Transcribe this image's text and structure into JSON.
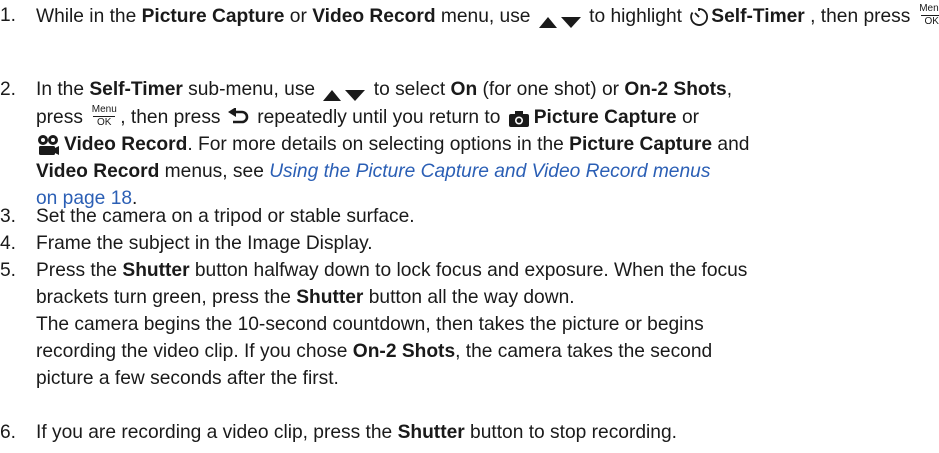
{
  "steps": [
    {
      "num": "1.",
      "a": "While in the ",
      "picture_capture": "Picture Capture",
      "or": " or ",
      "video_record": "Video Record",
      "b": " menu, use ",
      "c": " to highlight ",
      "self_timer": "Self-Timer",
      "d": " , then press ",
      "e": "."
    },
    {
      "num": "2.",
      "a": "In the ",
      "self_timer": "Self-Timer",
      "b": " sub-menu, use ",
      "c": " to select ",
      "on": "On",
      "d": " (for one shot) or ",
      "on2": "On-2 Shots",
      "e": ",",
      "f": "press ",
      "g": ", then press ",
      "h": " repeatedly until you return to ",
      "picture_capture": "Picture Capture",
      "i": " or",
      "video_record": "Video Record",
      "j": ". For more details on selecting options in the ",
      "picture_capture2": "Picture Capture",
      "k": " and",
      "video_record2": "Video Record",
      "l": " menus, see ",
      "xref_title": "Using the Picture Capture and Video Record menus",
      "xref_page": "on page 18",
      "m": "."
    },
    {
      "num": "3.",
      "text": "Set the camera on a tripod or stable surface."
    },
    {
      "num": "4.",
      "text": "Frame the subject in the Image Display."
    },
    {
      "num": "5.",
      "a": "Press the ",
      "shutter": "Shutter",
      "b": " button halfway down to lock focus and exposure. When the focus",
      "c": "brackets turn green, press the ",
      "shutter2": "Shutter",
      "d": " button all the way down.",
      "e": "The camera begins the 10-second countdown, then takes the picture or begins",
      "f": "recording the video clip. If you chose ",
      "on2": "On-2 Shots",
      "g": ", the camera takes the second",
      "h": "picture a few seconds after the first."
    },
    {
      "num": "6.",
      "a": "If you are recording a video clip, press the ",
      "shutter": "Shutter",
      "b": " button to stop recording."
    }
  ],
  "menu_ok": {
    "top": "Menu",
    "bottom": "OK"
  },
  "icons": {
    "arrows": "up-down-arrows-icon",
    "timer": "self-timer-icon",
    "menu_ok": "menu-ok-button-icon",
    "back": "back-arrow-icon",
    "camera": "camera-icon",
    "video": "video-record-icon"
  },
  "colors": {
    "text": "#1a1a1a",
    "link": "#2b5fb5"
  }
}
